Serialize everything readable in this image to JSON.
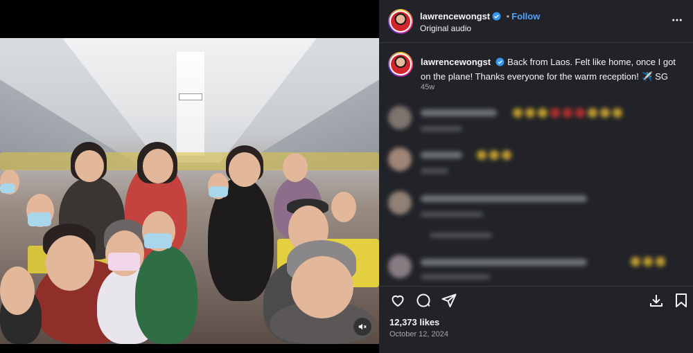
{
  "post": {
    "username": "lawrencewongst",
    "follow_label": "Follow",
    "audio_label": "Original audio",
    "caption": "Back from Laos. Felt like home, once I got on the plane! Thanks everyone for the warm reception! ✈️ SG",
    "age": "45w",
    "likes": "12,373 likes",
    "date": "October 12, 2024"
  },
  "icons": {
    "verified": "verified-badge-icon",
    "more": "more-options-icon",
    "like": "heart-icon",
    "comment": "comment-bubble-icon",
    "share": "paper-plane-icon",
    "download": "download-icon",
    "save": "bookmark-icon",
    "mute": "speaker-muted-icon"
  },
  "colors": {
    "panel_bg": "#212328",
    "accent_blue": "#4da3ff",
    "verified_blue": "#3897f0",
    "muted_text": "#a8a8a8"
  }
}
